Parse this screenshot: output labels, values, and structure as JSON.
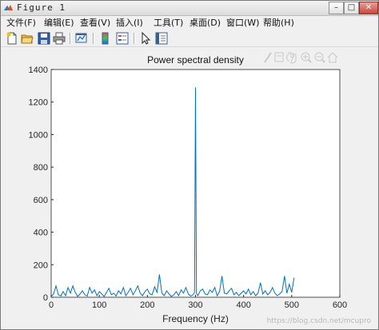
{
  "window": {
    "title": "Figure 1",
    "minimize": "–",
    "maximize": "□",
    "close": "✕"
  },
  "menu": [
    "文件(F)",
    "编辑(E)",
    "查看(V)",
    "插入(I)",
    "工具(T)",
    "桌面(D)",
    "窗口(W)",
    "帮助(H)"
  ],
  "toolbar_icons": [
    "new-figure-icon",
    "open-file-icon",
    "save-icon",
    "print-icon",
    "link-plot-icon",
    "insert-colorbar-icon",
    "insert-legend-icon",
    "edit-plot-arrow-icon",
    "property-inspector-icon"
  ],
  "axes_toolbar_icons": [
    "brush-icon",
    "data-tips-icon",
    "pan-hand-icon",
    "zoom-in-icon",
    "zoom-out-icon",
    "home-icon"
  ],
  "watermark": "https://blog.csdn.net/mcupro",
  "colors": {
    "line": "#0072bd",
    "accent_close": "#c8473c"
  },
  "chart_data": {
    "type": "line",
    "title": "Power spectral density",
    "xlabel": "Frequency (Hz)",
    "ylabel": "",
    "xlim": [
      0,
      600
    ],
    "ylim": [
      0,
      1400
    ],
    "xticks": [
      0,
      100,
      200,
      300,
      400,
      500,
      600
    ],
    "yticks": [
      0,
      200,
      400,
      600,
      800,
      1000,
      1200,
      1400
    ],
    "grid": false,
    "series": [
      {
        "x": [
          0,
          5,
          10,
          15,
          20,
          25,
          30,
          35,
          40,
          45,
          50,
          55,
          60,
          65,
          70,
          75,
          80,
          85,
          90,
          95,
          100,
          105,
          110,
          115,
          120,
          125,
          130,
          135,
          140,
          145,
          150,
          155,
          160,
          165,
          170,
          175,
          180,
          185,
          190,
          195,
          200,
          205,
          210,
          215,
          220,
          225,
          230,
          235,
          240,
          245,
          250,
          255,
          260,
          265,
          270,
          275,
          280,
          285,
          290,
          295,
          298,
          300,
          302,
          305,
          310,
          315,
          320,
          325,
          330,
          335,
          340,
          345,
          350,
          355,
          360,
          365,
          370,
          375,
          380,
          385,
          390,
          395,
          400,
          405,
          410,
          415,
          420,
          425,
          430,
          435,
          440,
          445,
          450,
          455,
          460,
          465,
          470,
          475,
          480,
          485,
          490,
          495,
          500,
          505
        ],
        "y": [
          5,
          20,
          70,
          15,
          8,
          35,
          10,
          60,
          25,
          70,
          30,
          5,
          20,
          40,
          15,
          8,
          60,
          25,
          45,
          10,
          35,
          20,
          5,
          30,
          55,
          15,
          25,
          8,
          40,
          20,
          60,
          10,
          30,
          55,
          15,
          40,
          70,
          25,
          10,
          35,
          50,
          20,
          15,
          65,
          30,
          140,
          25,
          10,
          40,
          20,
          5,
          15,
          35,
          10,
          45,
          25,
          60,
          20,
          8,
          15,
          30,
          1290,
          25,
          10,
          40,
          50,
          20,
          15,
          45,
          30,
          60,
          10,
          35,
          130,
          25,
          20,
          40,
          55,
          15,
          30,
          10,
          25,
          40,
          20,
          50,
          15,
          35,
          10,
          25,
          90,
          20,
          40,
          15,
          30,
          60,
          25,
          10,
          20,
          35,
          130,
          25,
          80,
          30,
          120
        ]
      }
    ]
  }
}
